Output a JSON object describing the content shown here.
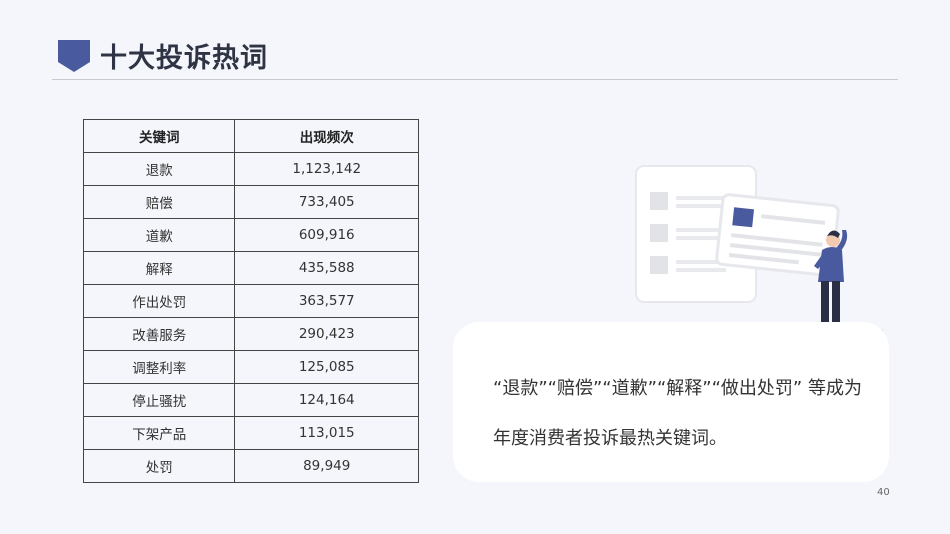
{
  "page": {
    "title": "十大投诉热词",
    "page_number": "40"
  },
  "table": {
    "headers": [
      "关键词",
      "出现频次"
    ],
    "rows": [
      [
        "退款",
        "1,123,142"
      ],
      [
        "赔偿",
        "733,405"
      ],
      [
        "道歉",
        "609,916"
      ],
      [
        "解释",
        "435,588"
      ],
      [
        "作出处罚",
        "363,577"
      ],
      [
        "改善服务",
        "290,423"
      ],
      [
        "调整利率",
        "125,085"
      ],
      [
        "停止骚扰",
        "124,164"
      ],
      [
        "下架产品",
        "113,015"
      ],
      [
        "处罚",
        "89,949"
      ]
    ]
  },
  "summary": {
    "text": "“退款”“赔偿”“道歉”“解释”“做出处罚” 等成为年度消费者投诉最热关键词。"
  },
  "colors": {
    "accent": "#4a5a9e",
    "background": "#f4f6fb",
    "card": "#ffffff"
  },
  "icons": {
    "title": "shield-icon",
    "illustration": "person-holding-card-illustration"
  }
}
